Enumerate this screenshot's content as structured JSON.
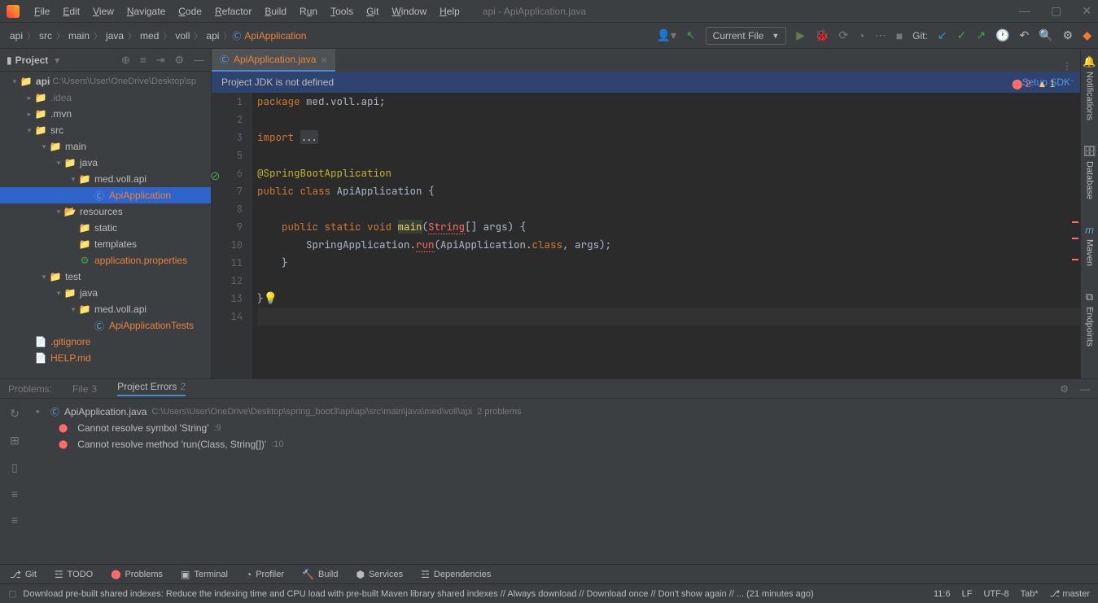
{
  "window": {
    "title": "api - ApiApplication.java"
  },
  "menu": [
    "File",
    "Edit",
    "View",
    "Navigate",
    "Code",
    "Refactor",
    "Build",
    "Run",
    "Tools",
    "Git",
    "Window",
    "Help"
  ],
  "breadcrumbs": [
    "api",
    "src",
    "main",
    "java",
    "med",
    "voll",
    "api",
    "ApiApplication"
  ],
  "nav": {
    "dropdown": "Current File",
    "git": "Git:"
  },
  "project": {
    "label": "Project",
    "root": {
      "name": "api",
      "path": "C:\\Users\\User\\OneDrive\\Desktop\\sp"
    },
    "idea": ".idea",
    "mvn": ".mvn",
    "src": "src",
    "mainf": "main",
    "javaf": "java",
    "pkg": "med.voll.api",
    "cls": "ApiApplication",
    "res": "resources",
    "static": "static",
    "tmpl": "templates",
    "appprops": "application.properties",
    "test": "test",
    "javatest": "java",
    "testpkg": "med.voll.api",
    "testcls": "ApiApplicationTests",
    "gitignore": ".gitignore",
    "help": "HELP.md"
  },
  "tab": {
    "label": "ApiApplication.java"
  },
  "jdk": {
    "msg": "Project JDK is not defined",
    "link": "Setup SDK"
  },
  "indicators": {
    "errors": "2",
    "warnings": "1"
  },
  "code": {
    "l1a": "package ",
    "l1b": "med.voll.api;",
    "l3": "import ...",
    "l6": "@SpringBootApplication",
    "l7a": "public class ",
    "l7b": "ApiApplication {",
    "l9a": "    public static void ",
    "l9b": "main",
    "l9c": "(",
    "l9d": "String",
    "l9e": "[] args) {",
    "l10a": "        SpringApplication.",
    "l10b": "run",
    "l10c": "(ApiApplication.",
    "l10d": "class",
    "l10e": ", args);",
    "l11": "    }",
    "l13": "}"
  },
  "problems": {
    "tabs": {
      "label": "Problems:",
      "file": "File",
      "file_n": "3",
      "proj": "Project Errors",
      "proj_n": "2"
    },
    "file": "ApiApplication.java",
    "path": "C:\\Users\\User\\OneDrive\\Desktop\\spring_boot3\\api\\api\\src\\main\\java\\med\\voll\\api",
    "count": "2 problems",
    "e1": "Cannot resolve symbol 'String'",
    "e1l": ":9",
    "e2": "Cannot resolve method 'run(Class, String[])'",
    "e2l": ":10"
  },
  "toolbar": [
    "Git",
    "TODO",
    "Problems",
    "Terminal",
    "Profiler",
    "Build",
    "Services",
    "Dependencies"
  ],
  "status": {
    "msg": "Download pre-built shared indexes: Reduce the indexing time and CPU load with pre-built Maven library shared indexes // Always download // Download once // Don't show again // ... (21 minutes ago)",
    "pos": "11:6",
    "sep": "LF",
    "enc": "UTF-8",
    "tab": "Tab*",
    "branch": "master"
  },
  "rightbar": [
    "Notifications",
    "Database",
    "Maven",
    "Endpoints"
  ]
}
